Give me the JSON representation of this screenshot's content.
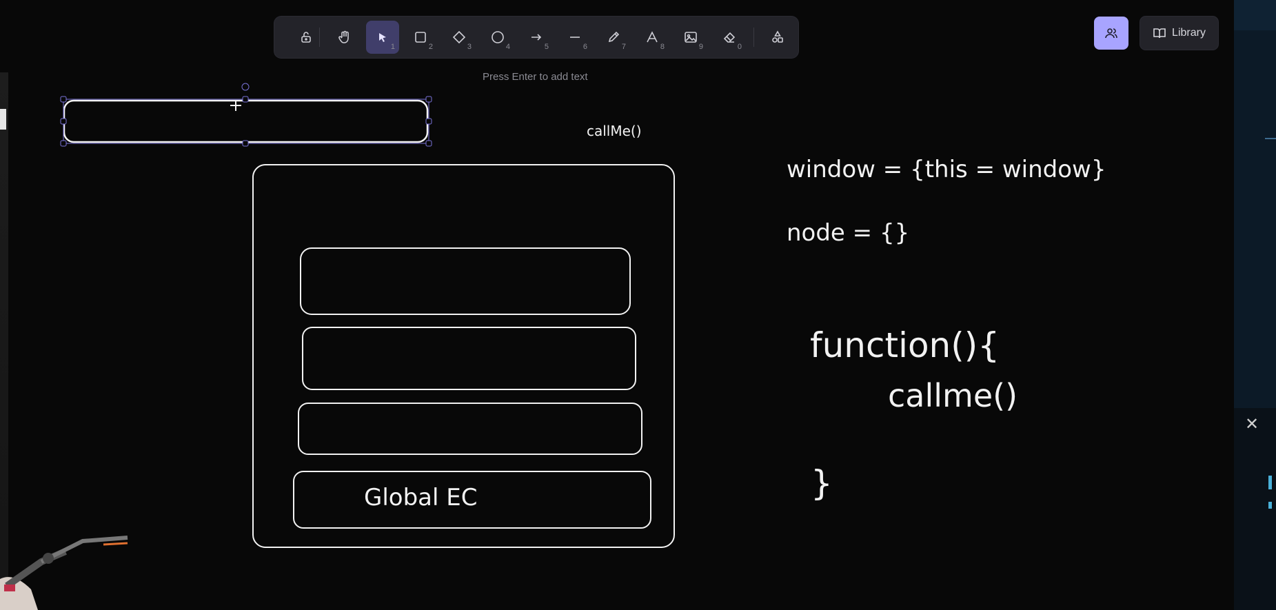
{
  "toolbar": {
    "tools": [
      {
        "name": "lock",
        "num": ""
      },
      {
        "name": "hand",
        "num": ""
      },
      {
        "name": "selection",
        "num": "1"
      },
      {
        "name": "rectangle",
        "num": "2"
      },
      {
        "name": "diamond",
        "num": "3"
      },
      {
        "name": "ellipse",
        "num": "4"
      },
      {
        "name": "arrow",
        "num": "5"
      },
      {
        "name": "line",
        "num": "6"
      },
      {
        "name": "draw",
        "num": "7"
      },
      {
        "name": "text",
        "num": "8"
      },
      {
        "name": "image",
        "num": "9"
      },
      {
        "name": "eraser",
        "num": "0"
      },
      {
        "name": "more-tools",
        "num": ""
      }
    ],
    "hint": "Press Enter to add text"
  },
  "header": {
    "library_label": "Library"
  },
  "canvas": {
    "callme_small": "callMe()",
    "window_line": "window = {this = window}",
    "node_line": "node = {}",
    "function_line": "function(){",
    "callme_line": "callme()",
    "closing_brace": "}",
    "global_ec": "Global EC"
  },
  "colors": {
    "accent": "#a8a4ff",
    "active_tool": "#403e6a",
    "toolbar_bg": "#232329",
    "canvas_bg": "#080808",
    "stroke": "#f2f2f2"
  }
}
